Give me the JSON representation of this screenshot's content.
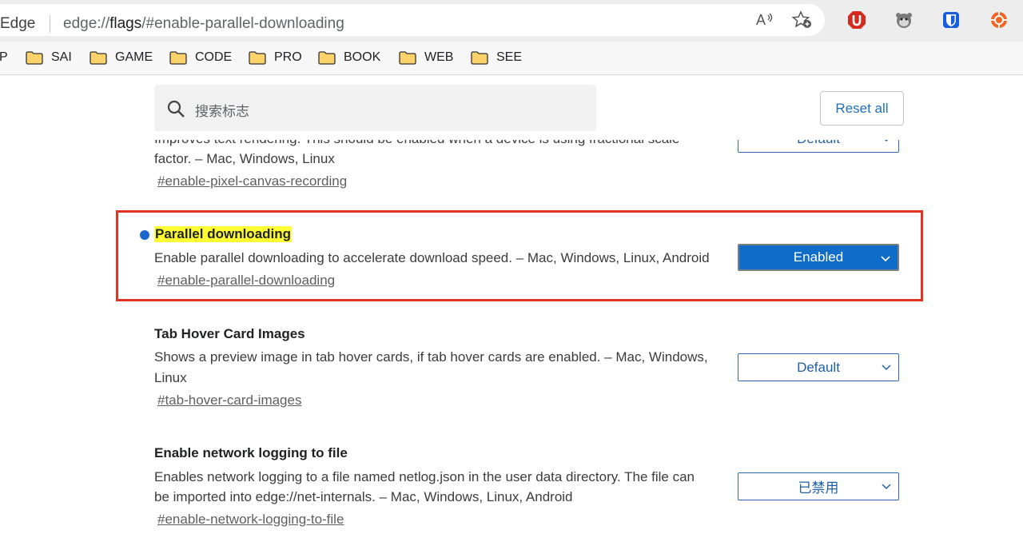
{
  "browser": {
    "app_name": "Edge",
    "url_scheme": "edge://",
    "url_host": "flags",
    "url_path": "/#enable-parallel-downloading"
  },
  "bookmarks": [
    {
      "label": "P"
    },
    {
      "label": "SAI"
    },
    {
      "label": "GAME"
    },
    {
      "label": "CODE"
    },
    {
      "label": "PRO"
    },
    {
      "label": "BOOK"
    },
    {
      "label": "WEB"
    },
    {
      "label": "SEE"
    }
  ],
  "flags_page": {
    "search_placeholder": "搜索标志",
    "reset_label": "Reset all",
    "partial_experiment": {
      "desc_line1": "Improves text rendering. This should be enabled when a device is using fractional scale",
      "desc_line2": "factor. – Mac, Windows, Linux",
      "link": "#enable-pixel-canvas-recording",
      "select_value": "Default"
    },
    "experiments": [
      {
        "title": "Parallel downloading",
        "description": "Enable parallel downloading to accelerate download speed. – Mac, Windows, Linux, Android",
        "link": "#enable-parallel-downloading",
        "select_value": "Enabled",
        "modified": true
      },
      {
        "title": "Tab Hover Card Images",
        "desc_line1": "Shows a preview image in tab hover cards, if tab hover cards are enabled. – Mac, Windows,",
        "desc_line2": "Linux",
        "link": "#tab-hover-card-images",
        "select_value": "Default",
        "modified": false
      },
      {
        "title": "Enable network logging to file",
        "desc_line1": "Enables network logging to a file named netlog.json in the user data directory. The file can",
        "desc_line2": "be imported into edge://net-internals. – Mac, Windows, Linux, Android",
        "link": "#enable-network-logging-to-file",
        "select_value": "已禁用",
        "modified": false
      }
    ]
  },
  "colors": {
    "highlight_border": "#e33323",
    "title_highlight": "#ffff33",
    "enabled_select": "#0f6cc8",
    "modified_dot": "#1a66c9"
  }
}
